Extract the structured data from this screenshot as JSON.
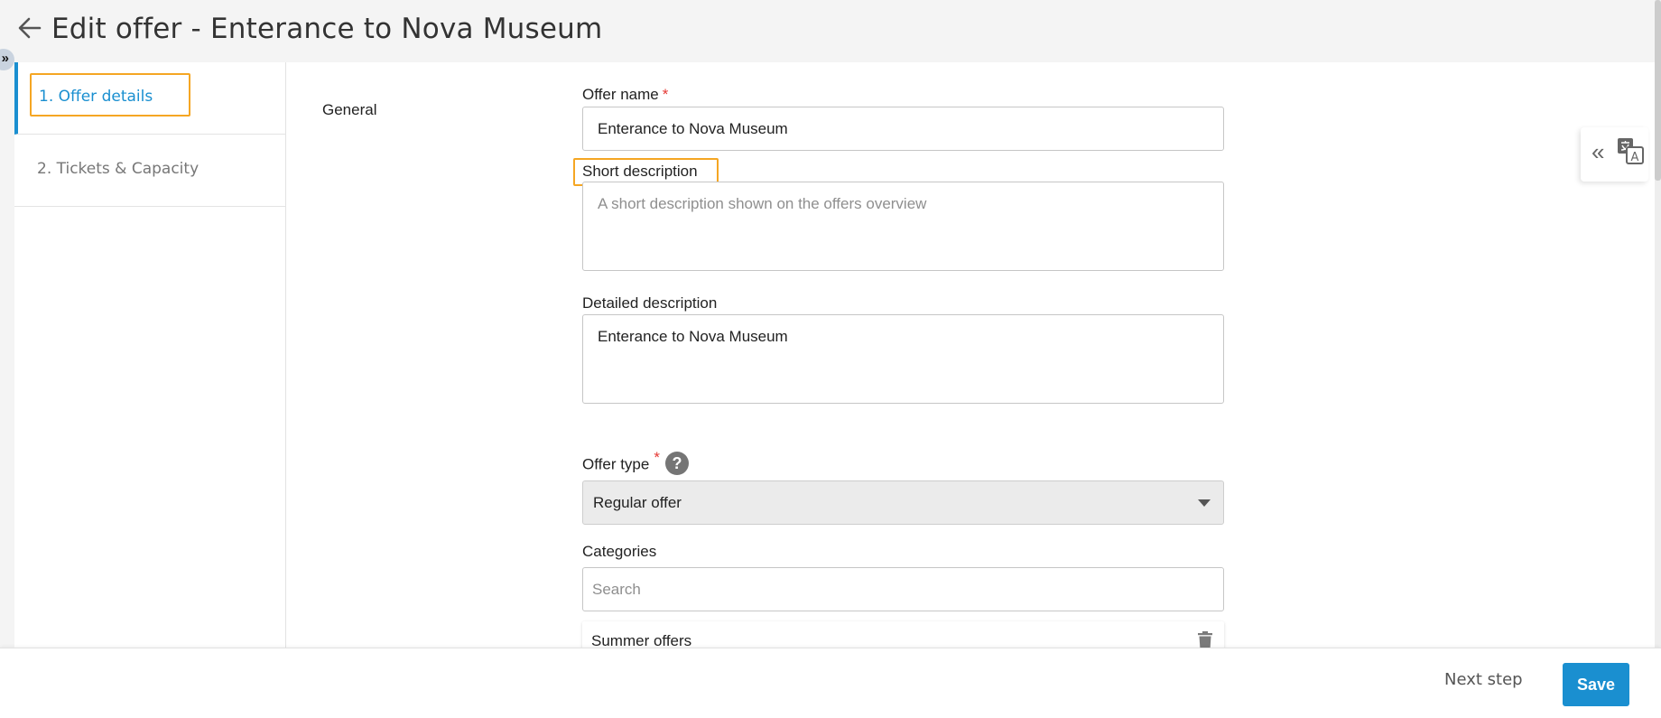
{
  "header": {
    "title": "Edit offer - Enterance to Nova Museum",
    "back_icon": "arrow-left-icon",
    "edge_toggle": "»"
  },
  "steps": [
    {
      "label": "1. Offer details",
      "active": true
    },
    {
      "label": "2. Tickets & Capacity",
      "active": false
    }
  ],
  "form": {
    "section": "General",
    "offer_name": {
      "label": "Offer name",
      "required": "*",
      "value": "Enterance to Nova Museum"
    },
    "short_description": {
      "label": "Short description",
      "placeholder": "A short description shown on the offers overview",
      "value": ""
    },
    "detailed_description": {
      "label": "Detailed description",
      "value": "Enterance to Nova Museum"
    },
    "offer_type": {
      "label": "Offer type",
      "required": "*",
      "help": "?",
      "selected": "Regular offer"
    },
    "categories": {
      "label": "Categories",
      "search_placeholder": "Search",
      "items": [
        "Summer offers"
      ]
    }
  },
  "footer": {
    "next_label": "Next step",
    "save_label": "Save"
  },
  "colors": {
    "accent": "#1a8fd0",
    "highlight": "#f5a623",
    "required": "#e53935"
  }
}
